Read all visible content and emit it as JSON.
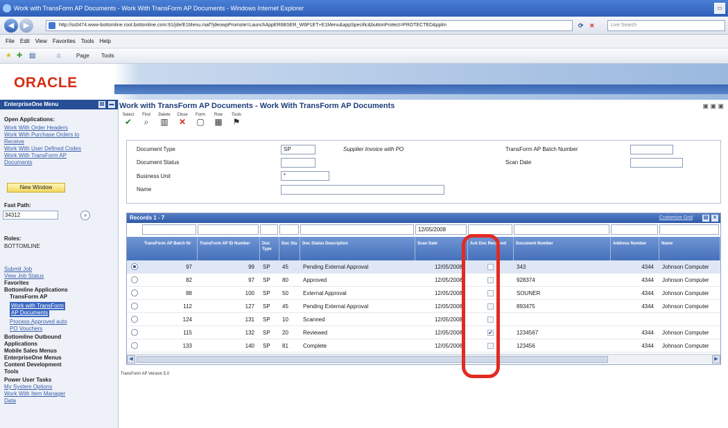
{
  "browser": {
    "window_title": "Work with TransForm AP Documents - Work With TransForm AP Documents - Windows Internet Explorer",
    "url": "http://ss0474.www-bottomline.root.bottomline.com:91/jde/E1Menu.maf?jdeowpPromote=LaunchAppER6BSER_W6P1ET+E1Menu&appSpecific&buttonProtect=PROTECTED&pplm",
    "live_search_placeholder": "Live Search",
    "menu": [
      "File",
      "Edit",
      "View",
      "Favorites",
      "Tools",
      "Help"
    ],
    "fav_items": [
      "Page",
      "Tools"
    ]
  },
  "header": {
    "logo": "ORACLE"
  },
  "sidebar": {
    "menu_title": "EnterpriseOne Menu",
    "open_apps_label": "Open Applications:",
    "open_apps": [
      "Work With Order Headers",
      "Work With Purchase Orders to",
      "Receive",
      "Work With User Defined Codes",
      "Work With TransForm AP",
      "Documents"
    ],
    "new_window": "New Window",
    "fast_path_label": "Fast Path:",
    "fast_path_value": "34312",
    "roles_label": "Roles:",
    "roles_value": "BOTTOMLINE",
    "nav": [
      {
        "text": "Submit Job",
        "style": "l"
      },
      {
        "text": "View Job Status",
        "style": "l"
      },
      {
        "text": "Favorites",
        "style": ""
      },
      {
        "text": "Bottomline Applications",
        "style": ""
      },
      {
        "text": "TransForm AP",
        "style": ""
      },
      {
        "text": "Work with TransForm",
        "style": "sel"
      },
      {
        "text": "AP Documents",
        "style": "sel"
      },
      {
        "text": "Process Approved auto",
        "style": "l"
      },
      {
        "text": "PO Vouchers",
        "style": "l"
      },
      {
        "text": "Bottomline Outbound",
        "style": ""
      },
      {
        "text": "Applications",
        "style": ""
      },
      {
        "text": "Mobile Sales Menus",
        "style": ""
      },
      {
        "text": "EnterpriseOne Menus",
        "style": ""
      },
      {
        "text": "Content Development",
        "style": ""
      },
      {
        "text": "Tools",
        "style": ""
      },
      {
        "text": "Power User Tasks",
        "style": ""
      },
      {
        "text": "My System Options",
        "style": "l"
      },
      {
        "text": "Work With Item Manager",
        "style": "l"
      },
      {
        "text": "Data",
        "style": "l"
      }
    ]
  },
  "form": {
    "title": "Work with TransForm AP Documents - Work With TransForm AP Documents",
    "toolbar": [
      "Select",
      "Find",
      "Delete",
      "Close",
      "Form",
      "Row",
      "Tools"
    ],
    "filters": {
      "doc_type_label": "Document Type",
      "doc_type_value": "SP",
      "doc_type_desc": "Supplier Invoice with PO",
      "doc_status_label": "Document Status",
      "business_unit_label": "Business Unit",
      "business_unit_value": "*",
      "name_label": "Name",
      "batch_label": "TransForm AP Batch Number",
      "scan_date_label": "Scan Date"
    }
  },
  "grid": {
    "records": "Records 1 - 7",
    "customize": "Customize Grid",
    "qbe_date": "12/05/2008",
    "columns": [
      "TransForm AP Batch Nr",
      "TransForm AP ID Number",
      "Doc Type",
      "Doc Sta",
      "Doc Status Description",
      "Scan Date",
      "Ack Doc Received",
      "Document Number",
      "Address Number",
      "Name"
    ],
    "rows": [
      {
        "batch": "97",
        "id": "99",
        "type": "SP",
        "sta": "45",
        "desc": "Pending External Approval",
        "date": "12/05/2008",
        "ack": false,
        "docnum": "343",
        "addr": "4344",
        "name": "Johnson Computer",
        "selected": true
      },
      {
        "batch": "82",
        "id": "97",
        "type": "SP",
        "sta": "80",
        "desc": "Approved",
        "date": "12/05/2008",
        "ack": false,
        "docnum": "928374",
        "addr": "4344",
        "name": "Johnson Computer",
        "selected": false
      },
      {
        "batch": "88",
        "id": "100",
        "type": "SP",
        "sta": "50",
        "desc": "External Approval",
        "date": "12/05/2008",
        "ack": false,
        "docnum": "SOUNER",
        "addr": "4344",
        "name": "Johnson Computer",
        "selected": false
      },
      {
        "batch": "112",
        "id": "127",
        "type": "SP",
        "sta": "45",
        "desc": "Pending External Approval",
        "date": "12/05/2008",
        "ack": false,
        "docnum": "893475",
        "addr": "4344",
        "name": "Johnson Computer",
        "selected": false
      },
      {
        "batch": "124",
        "id": "131",
        "type": "SP",
        "sta": "10",
        "desc": "Scanned",
        "date": "12/05/2008",
        "ack": false,
        "docnum": "",
        "addr": "",
        "name": "",
        "selected": false
      },
      {
        "batch": "115",
        "id": "132",
        "type": "SP",
        "sta": "20",
        "desc": "Reviewed",
        "date": "12/05/2008",
        "ack": true,
        "docnum": "1234567",
        "addr": "4344",
        "name": "Johnson Computer",
        "selected": false
      },
      {
        "batch": "133",
        "id": "140",
        "type": "SP",
        "sta": "81",
        "desc": "Complete",
        "date": "12/05/2008",
        "ack": false,
        "docnum": "123456",
        "addr": "4344",
        "name": "Johnson Computer",
        "selected": false
      }
    ]
  },
  "footer_version": "TransForm AP Version 5.0"
}
